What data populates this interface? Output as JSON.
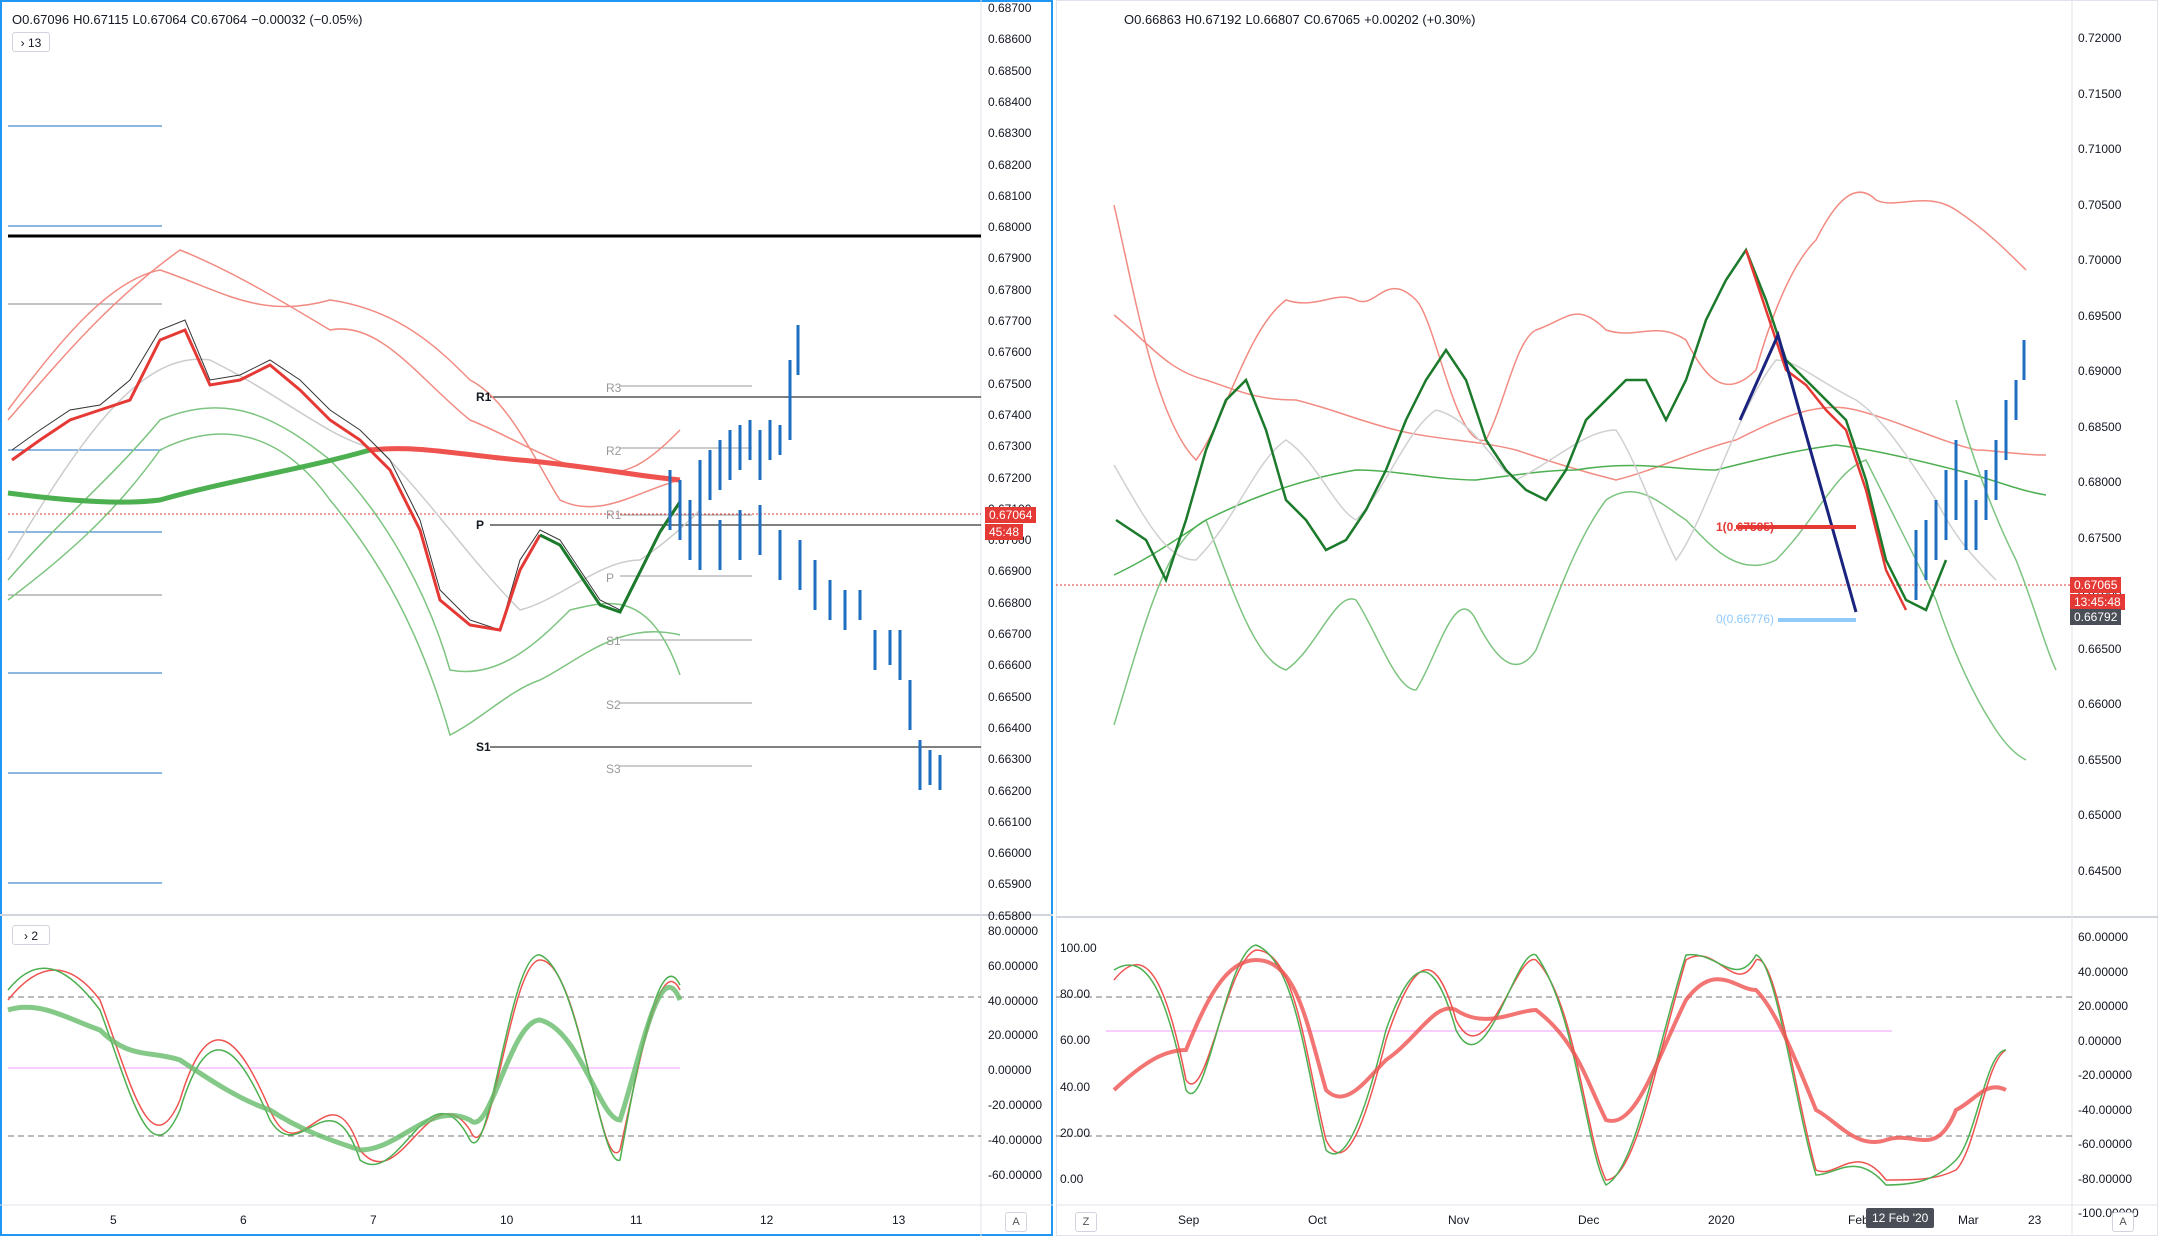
{
  "left_chart": {
    "ohlc": {
      "o": "O0.67096",
      "h": "H0.67115",
      "l": "L0.67064",
      "c": "C0.67064",
      "chg": "−0.00032 (−0.05%)"
    },
    "collapse_main": "› 13",
    "collapse_osc": "› 2",
    "price_axis": [
      "0.68700",
      "0.68600",
      "0.68500",
      "0.68400",
      "0.68300",
      "0.68200",
      "0.68100",
      "0.68000",
      "0.67900",
      "0.67800",
      "0.67700",
      "0.67600",
      "0.67500",
      "0.67400",
      "0.67300",
      "0.67200",
      "0.67100",
      "0.67000",
      "0.66900",
      "0.66800",
      "0.66700",
      "0.66600",
      "0.66500",
      "0.66400",
      "0.66300",
      "0.66200",
      "0.66100",
      "0.66000",
      "0.65900",
      "0.65800"
    ],
    "price_tag": "0.67064",
    "countdown_tag": "45:48",
    "osc_axis": [
      "80.00000",
      "60.00000",
      "40.00000",
      "20.00000",
      "0.00000",
      "-20.00000",
      "-40.00000",
      "-60.00000"
    ],
    "time_axis": [
      "5",
      "6",
      "7",
      "10",
      "11",
      "12",
      "13"
    ],
    "pivot_labels": {
      "r1": "R1",
      "p": "P",
      "s1": "S1",
      "r3": "R3",
      "r2": "R2",
      "r1b": "R1",
      "pb": "P",
      "s1b": "S1",
      "s2": "S2",
      "s3": "S3"
    },
    "auto_btn": "A"
  },
  "right_chart": {
    "ohlc": {
      "o": "O0.66863",
      "h": "H0.67192",
      "l": "L0.66807",
      "c": "C0.67065",
      "chg": "+0.00202 (+0.30%)"
    },
    "price_axis": [
      "0.72000",
      "0.71500",
      "0.71000",
      "0.70500",
      "0.70000",
      "0.69500",
      "0.69000",
      "0.68500",
      "0.68000",
      "0.67500",
      "0.67000",
      "0.66500",
      "0.66000",
      "0.65500",
      "0.65000",
      "0.64500"
    ],
    "price_tag": "0.67065",
    "countdown_tag": "13:45:48",
    "low_tag": "0.66792",
    "fib_1": "1(0.67595)",
    "fib_0": "0(0.66776)",
    "osc_left_axis": [
      "100.00",
      "80.00",
      "60.00",
      "40.00",
      "20.00",
      "0.00"
    ],
    "osc_right_axis": [
      "60.00000",
      "40.00000",
      "20.00000",
      "0.00000",
      "-20.00000",
      "-40.00000",
      "-60.00000",
      "-80.00000",
      "-100.00000"
    ],
    "time_axis": [
      "Sep",
      "Oct",
      "Nov",
      "Dec",
      "2020",
      "Feb",
      "Mar",
      "23"
    ],
    "date_pill": "12 Feb '20",
    "z_btn": "Z",
    "auto_btn": "A"
  },
  "colors": {
    "up": "#1b7a2b",
    "down": "#e53935",
    "blue": "#1e6fc2",
    "red_tag": "#e53935",
    "dark_tag": "#4a4e57",
    "navy": "#1a237e"
  }
}
